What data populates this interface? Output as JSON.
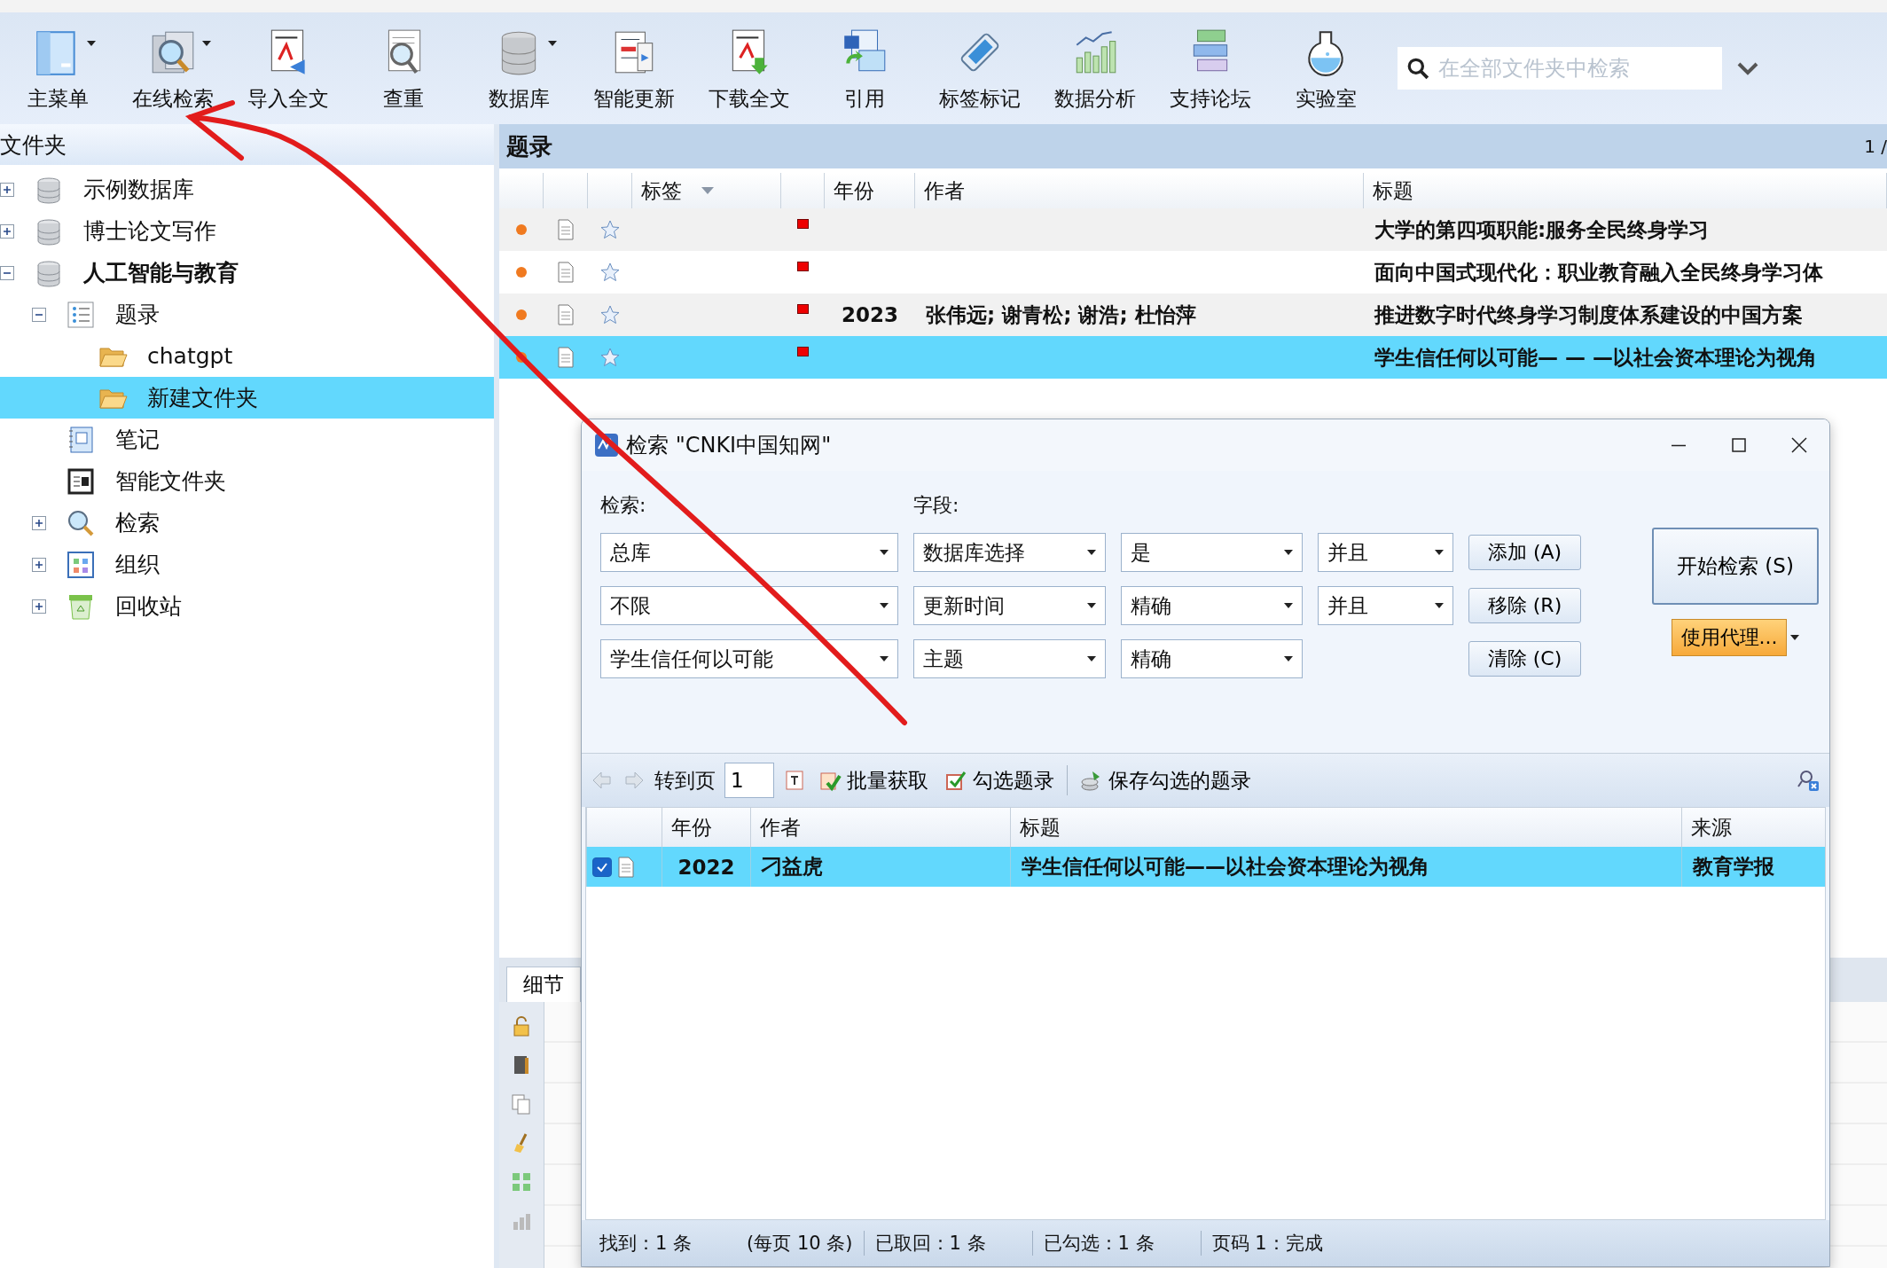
{
  "toolbar": {
    "items": [
      {
        "label": "主菜单",
        "dropdown": true
      },
      {
        "label": "在线检索",
        "dropdown": true
      },
      {
        "label": "导入全文",
        "dropdown": false
      },
      {
        "label": "查重",
        "dropdown": false
      },
      {
        "label": "数据库",
        "dropdown": true
      },
      {
        "label": "智能更新",
        "dropdown": false
      },
      {
        "label": "下载全文",
        "dropdown": false
      },
      {
        "label": "引用",
        "dropdown": false
      },
      {
        "label": "标签标记",
        "dropdown": false
      },
      {
        "label": "数据分析",
        "dropdown": false
      },
      {
        "label": "支持论坛",
        "dropdown": false
      },
      {
        "label": "实验室",
        "dropdown": false
      }
    ],
    "search": {
      "placeholder": "在全部文件夹中检索"
    }
  },
  "folders": {
    "title": "文件夹",
    "tree": [
      {
        "kind": "database",
        "label": "示例数据库",
        "expanded": false,
        "selected": false,
        "current": false
      },
      {
        "kind": "database",
        "label": "博士论文写作",
        "expanded": false,
        "selected": false,
        "current": false
      },
      {
        "kind": "database",
        "label": "人工智能与教育",
        "expanded": true,
        "selected": false,
        "current": true,
        "children": [
          {
            "kind": "list",
            "label": "题录",
            "expanded": true,
            "selected": false,
            "current": false,
            "children": [
              {
                "kind": "folder",
                "label": "chatgpt",
                "selected": false,
                "current": false
              },
              {
                "kind": "folder",
                "label": "新建文件夹",
                "selected": true,
                "current": false
              }
            ]
          },
          {
            "kind": "notes",
            "label": "笔记",
            "selected": false,
            "current": false
          },
          {
            "kind": "smart",
            "label": "智能文件夹",
            "selected": false,
            "current": false
          },
          {
            "kind": "search",
            "label": "检索",
            "expanded": false,
            "selected": false,
            "current": false
          },
          {
            "kind": "organize",
            "label": "组织",
            "expanded": false,
            "selected": false,
            "current": false
          },
          {
            "kind": "trash",
            "label": "回收站",
            "expanded": false,
            "selected": false,
            "current": false
          }
        ]
      }
    ]
  },
  "records": {
    "title": "题录",
    "page": "1 /",
    "columns": [
      "标签",
      "年份",
      "作者",
      "标题"
    ],
    "rows": [
      {
        "tag": "",
        "year": "",
        "authors": "",
        "title": "大学的第四项职能:服务全民终身学习",
        "selected": false
      },
      {
        "tag": "",
        "year": "",
        "authors": "",
        "title": "面向中国式现代化：职业教育融入全民终身学习体",
        "selected": false
      },
      {
        "tag": "",
        "year": "2023",
        "authors": "张伟远; 谢青松; 谢浩; 杜怡萍",
        "title": "推进数字时代终身学习制度体系建设的中国方案",
        "selected": false
      },
      {
        "tag": "",
        "year": "",
        "authors": "",
        "title": "学生信任何以可能— — —以社会资本理论为视角",
        "selected": true
      }
    ]
  },
  "details": {
    "tab": "细节"
  },
  "dialog": {
    "title": "检索 \"CNKI中国知网\"",
    "search_label": "检索:",
    "field_label": "字段:",
    "criteria": [
      {
        "term": "总库",
        "field": "数据库选择",
        "match": "是",
        "logic": "并且",
        "button": "添加 (A)"
      },
      {
        "term": "不限",
        "field": "更新时间",
        "match": "精确",
        "logic": "并且",
        "button": "移除 (R)"
      },
      {
        "term": "学生信任何以可能",
        "field": "主题",
        "match": "精确",
        "button": "清除 (C)"
      }
    ],
    "start_button": "开始检索 (S)",
    "proxy_button": "使用代理...",
    "toolbar": {
      "goto_label": "转到页",
      "page": "1",
      "fetch": "批量获取",
      "check": "勾选题录",
      "save": "保存勾选的题录"
    },
    "columns": [
      "年份",
      "作者",
      "标题",
      "来源"
    ],
    "results": [
      {
        "checked": true,
        "selected": true,
        "year": "2022",
        "author": "刁益虎",
        "title": "学生信任何以可能——以社会资本理论为视角",
        "source": "教育学报"
      }
    ],
    "status": [
      "找到：1 条",
      "(每页 10 条)",
      "已取回：1 条",
      "已勾选：1 条",
      "页码 1：完成"
    ]
  }
}
